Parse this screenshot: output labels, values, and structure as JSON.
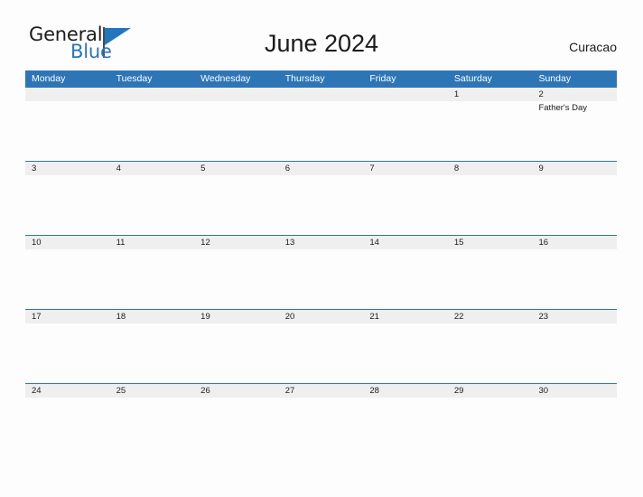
{
  "brand": {
    "name_part1": "General",
    "name_part2": "Blue",
    "flag_icon": "triangle-flag-icon",
    "color_primary": "#2e75b6",
    "color_text": "#1b1b1b"
  },
  "header": {
    "title": "June 2024",
    "location": "Curacao"
  },
  "calendar": {
    "header_bg": "#2e75b6",
    "date_band_bg": "#efefef",
    "divider_color": "#2e75b6",
    "weekdays": [
      "Monday",
      "Tuesday",
      "Wednesday",
      "Thursday",
      "Friday",
      "Saturday",
      "Sunday"
    ],
    "weeks": [
      {
        "days": [
          {
            "num": "",
            "event": ""
          },
          {
            "num": "",
            "event": ""
          },
          {
            "num": "",
            "event": ""
          },
          {
            "num": "",
            "event": ""
          },
          {
            "num": "",
            "event": ""
          },
          {
            "num": "1",
            "event": ""
          },
          {
            "num": "2",
            "event": "Father's Day"
          }
        ]
      },
      {
        "days": [
          {
            "num": "3",
            "event": ""
          },
          {
            "num": "4",
            "event": ""
          },
          {
            "num": "5",
            "event": ""
          },
          {
            "num": "6",
            "event": ""
          },
          {
            "num": "7",
            "event": ""
          },
          {
            "num": "8",
            "event": ""
          },
          {
            "num": "9",
            "event": ""
          }
        ]
      },
      {
        "days": [
          {
            "num": "10",
            "event": ""
          },
          {
            "num": "11",
            "event": ""
          },
          {
            "num": "12",
            "event": ""
          },
          {
            "num": "13",
            "event": ""
          },
          {
            "num": "14",
            "event": ""
          },
          {
            "num": "15",
            "event": ""
          },
          {
            "num": "16",
            "event": ""
          }
        ]
      },
      {
        "days": [
          {
            "num": "17",
            "event": ""
          },
          {
            "num": "18",
            "event": ""
          },
          {
            "num": "19",
            "event": ""
          },
          {
            "num": "20",
            "event": ""
          },
          {
            "num": "21",
            "event": ""
          },
          {
            "num": "22",
            "event": ""
          },
          {
            "num": "23",
            "event": ""
          }
        ]
      },
      {
        "days": [
          {
            "num": "24",
            "event": ""
          },
          {
            "num": "25",
            "event": ""
          },
          {
            "num": "26",
            "event": ""
          },
          {
            "num": "27",
            "event": ""
          },
          {
            "num": "28",
            "event": ""
          },
          {
            "num": "29",
            "event": ""
          },
          {
            "num": "30",
            "event": ""
          }
        ]
      }
    ]
  }
}
